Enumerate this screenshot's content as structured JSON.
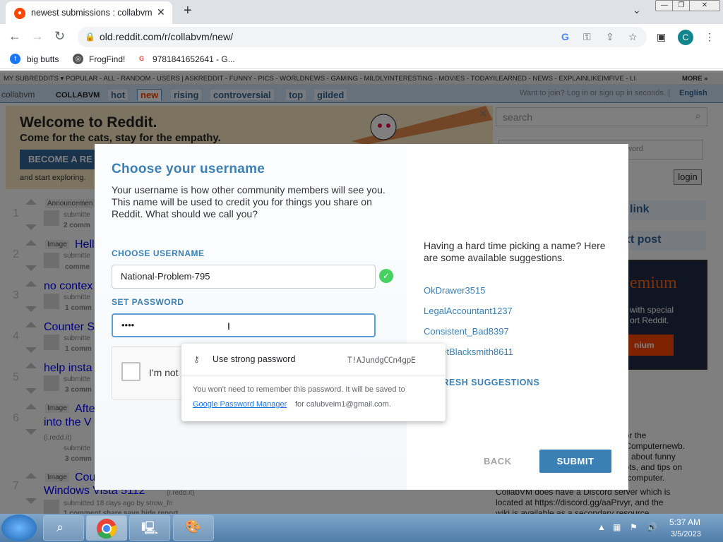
{
  "browser": {
    "tab_title": "newest submissions : collabvm",
    "url": "old.reddit.com/r/collabvm/new/",
    "profile_initial": "C",
    "bookmarks": [
      "big butts",
      "FrogFind!",
      "9781841652641 - G..."
    ]
  },
  "reddit": {
    "subreddit_bar": "MY SUBREDDITS ▾  POPULAR - ALL - RANDOM - USERS  |  ASKREDDIT - FUNNY - PICS - WORLDNEWS - GAMING - MILDLYINTERESTING - MOVIES - TODAYILEARNED - NEWS - EXPLAINLIKEIMFIVE - LI",
    "more": "MORE »",
    "logo_alt": "collabvm",
    "sub_name": "COLLABVM",
    "tabs": [
      "hot",
      "new",
      "rising",
      "controversial",
      "top",
      "gilded"
    ],
    "login_hint": "Want to join? Log in or sign up in seconds. |",
    "language": "English",
    "banner_title": "Welcome to Reddit.",
    "banner_sub": "Come for the cats, stay for the empathy.",
    "banner_button": "BECOME A RE",
    "banner_explore": "and start exploring.",
    "search_placeholder": "search",
    "login_button": "login",
    "password_placeholder": "word",
    "side_link": "link",
    "side_post": "xt post",
    "premium_title": "emium",
    "premium_text": "with special\nort Reddit.",
    "premium_btn": "nium",
    "posts": [
      {
        "rank": "1",
        "tag": "Announcemen",
        "title": "",
        "meta": "submitte",
        "comments": "2 comm"
      },
      {
        "rank": "2",
        "tag": "Image",
        "title": "Hell",
        "meta": "submitte",
        "comments": "comme"
      },
      {
        "rank": "3",
        "tag": "",
        "title": "no contex",
        "meta": "submitte",
        "comments": "1 comm"
      },
      {
        "rank": "4",
        "tag": "",
        "title": "Counter S",
        "meta": "submitte",
        "comments": "1 comm"
      },
      {
        "rank": "5",
        "tag": "",
        "title": "help insta",
        "meta": "submitte",
        "comments": "3 comm"
      },
      {
        "rank": "6",
        "tag": "Image",
        "title": "After",
        "title2": "into the V",
        "meta": "(i.redd.it)",
        "meta2": "submitte",
        "comments": "3 comm"
      },
      {
        "rank": "7",
        "tag": "Image",
        "title": "Cou",
        "title2": "Windows Vista 5112",
        "meta": "(i.redd.it)",
        "meta2": "submitted 18 days ago by strow_fn",
        "comments": "1 comment share save hide report"
      }
    ],
    "sidebar_text": "lt for the\nat Computernewb.\ntalk about funny\nshots, and tips on\nne computer.",
    "sidebar_discord": "CollabVM does have a Discord server which is\nlocated at https://discord.gg/aaPrvyr, and the\nwiki is available as a secondary resource."
  },
  "modal": {
    "title": "Choose your username",
    "description": "Your username is how other community members will see you. This name will be used to credit you for things you share on Reddit. What should we call you?",
    "username_label": "CHOOSE USERNAME",
    "username_value": "National-Problem-795",
    "password_label": "SET PASSWORD",
    "password_value": "••••",
    "captcha_text": "I'm not",
    "suggestion_hint": "Having a hard time picking a name? Here are some available suggestions.",
    "suggestions": [
      "OkDrawer3515",
      "LegalAccountant1237",
      "Consistent_Bad8397",
      "SweetBlacksmith8611"
    ],
    "refresh": "REFRESH SUGGESTIONS",
    "back": "BACK",
    "submit": "SUBMIT"
  },
  "password_popup": {
    "option": "Use strong password",
    "generated": "T!AJundgCCn4gpE",
    "note": "You won't need to remember this password. It will be saved to",
    "manager_link": "Google Password Manager",
    "note_end": "for calubveim1@gmail.com."
  },
  "taskbar": {
    "time": "5:37 AM",
    "date": "3/5/2023"
  }
}
